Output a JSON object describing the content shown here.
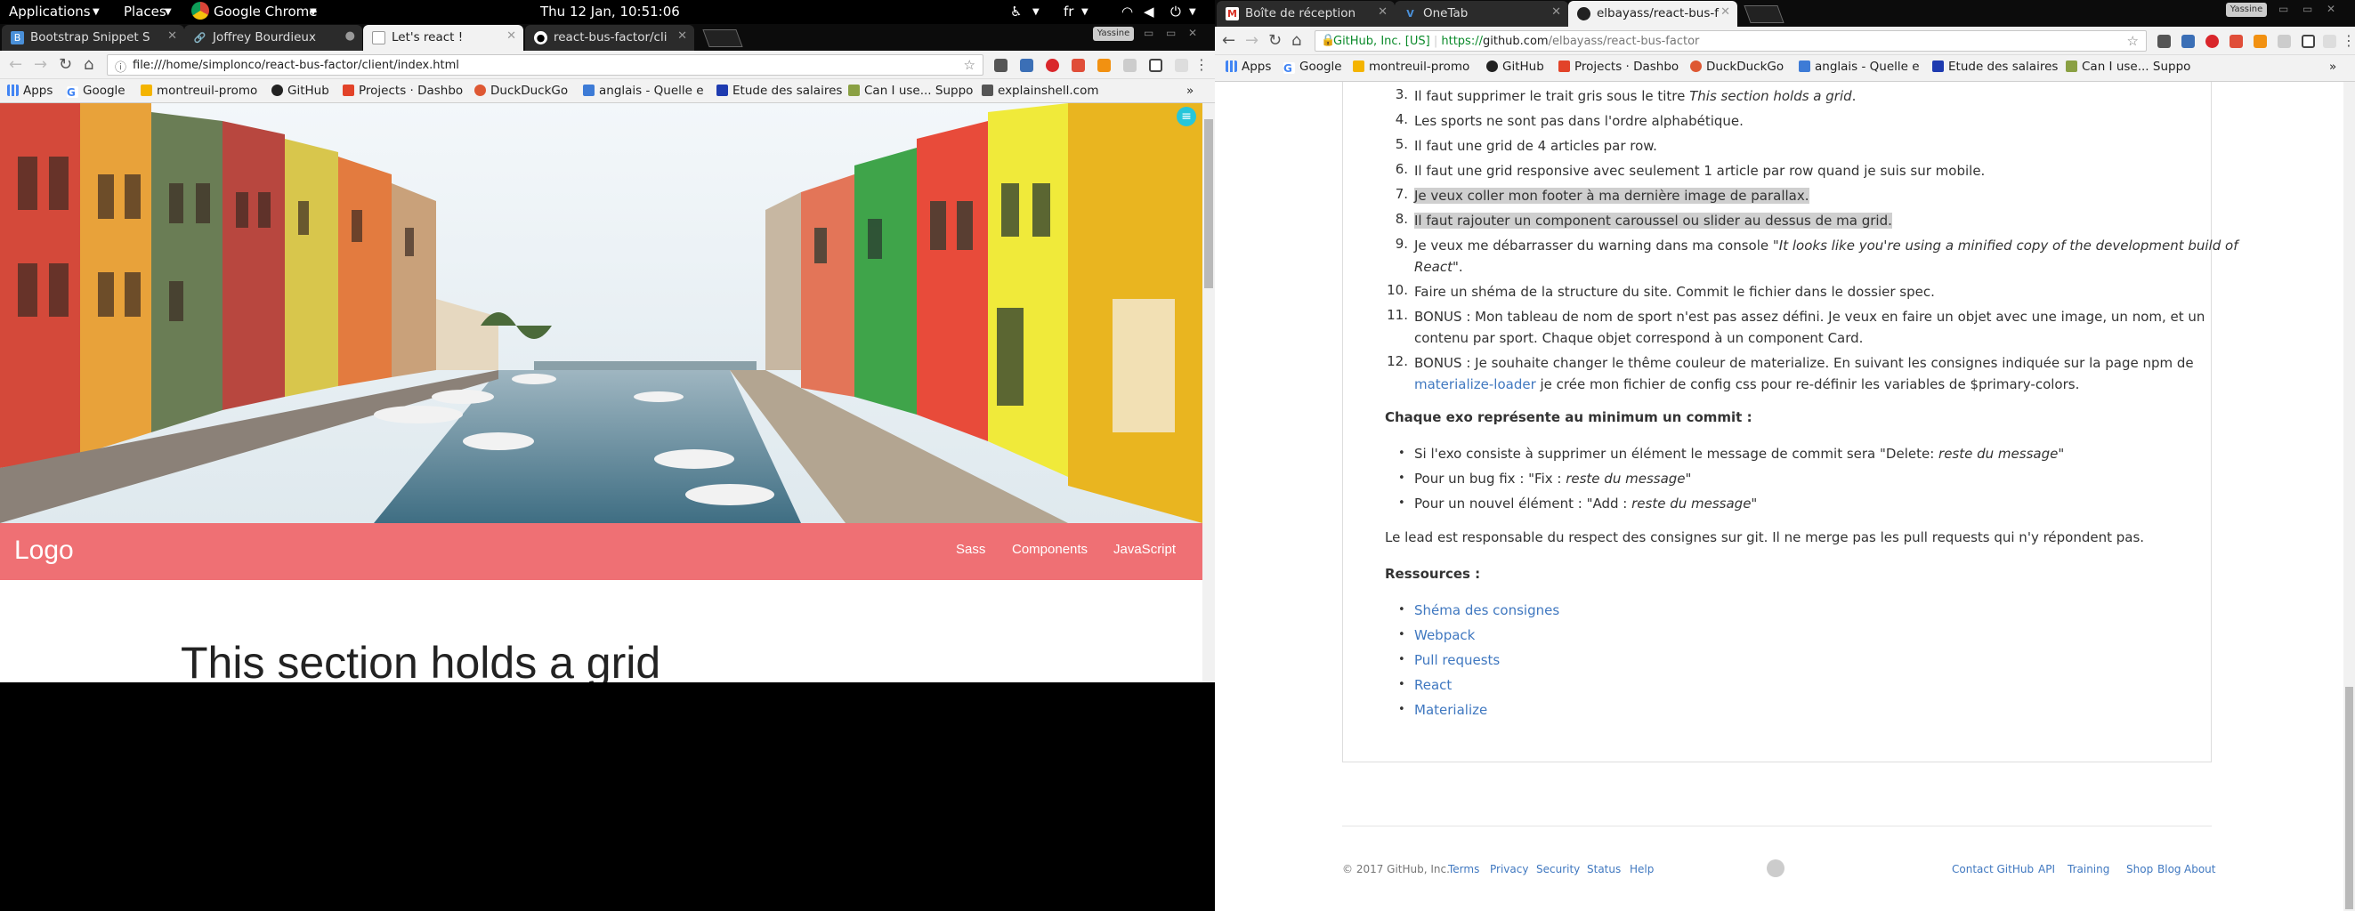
{
  "panel": {
    "applications": "Applications",
    "places": "Places",
    "app_name": "Google Chrome",
    "clock": "Thu 12 Jan, 10:51:06",
    "lang": "fr",
    "user": "Yassine"
  },
  "left_browser": {
    "tabs": [
      {
        "label": "Bootstrap Snippet S",
        "fav": "B",
        "active": false
      },
      {
        "label": "Joffrey Bourdieux",
        "fav": "",
        "active": false
      },
      {
        "label": "Let's react !",
        "fav": "",
        "active": true
      },
      {
        "label": "react-bus-factor/cli",
        "fav": "",
        "active": false
      }
    ],
    "url": "file:///home/simplonco/react-bus-factor/client/index.html",
    "bookmarks": [
      "Apps",
      "Google",
      "montreuil-promo",
      "GitHub",
      "Projects · Dashbo",
      "DuckDuckGo",
      "anglais - Quelle e",
      "Etude des salaires",
      "Can I use... Suppo",
      "explainshell.com"
    ],
    "page": {
      "logo": "Logo",
      "nav": [
        "Sass",
        "Components",
        "JavaScript"
      ],
      "section_title": "This section holds a grid"
    }
  },
  "right_browser": {
    "tabs": [
      {
        "label": "Boîte de réception",
        "active": false
      },
      {
        "label": "OneTab",
        "active": false
      },
      {
        "label": "elbayass/react-bus-f",
        "active": true
      }
    ],
    "site_identity": "GitHub, Inc. [US]",
    "url_scheme": "https://",
    "url_host": "github.com",
    "url_path": "/elbayass/react-bus-factor",
    "bookmarks": [
      "Apps",
      "Google",
      "montreuil-promo",
      "GitHub",
      "Projects · Dashbo",
      "DuckDuckGo",
      "anglais - Quelle e",
      "Etude des salaires",
      "Can I use... Suppo"
    ],
    "readme": {
      "items": [
        {
          "n": "3.",
          "text": "Il faut supprimer le trait gris sous le titre ",
          "em": "This section holds a grid",
          "tail": "."
        },
        {
          "n": "4.",
          "text": "Les sports ne sont pas dans l'ordre alphabétique."
        },
        {
          "n": "5.",
          "text": "Il faut une grid de 4 articles par row."
        },
        {
          "n": "6.",
          "text": "Il faut une grid responsive avec seulement 1 article par row quand je suis sur mobile."
        },
        {
          "n": "7.",
          "text": "Je veux coller mon footer à ma dernière image de parallax."
        },
        {
          "n": "8.",
          "text": "Il faut rajouter un component caroussel ou slider au dessus de ma grid."
        },
        {
          "n": "9.",
          "text": "Je veux me débarrasser du warning dans ma console ",
          "em": "\"It looks like you're using a minified copy of the development build of",
          "line2_em": "React\"",
          "line2_tail": "."
        },
        {
          "n": "10.",
          "text": "Faire un shéma de la structure du site. Commit le fichier dans le dossier spec."
        },
        {
          "n": "11.",
          "text": "BONUS : Mon tableau de nom de sport n'est pas assez défini. Je veux en faire un objet avec une image, un nom, et un",
          "line2": "contenu par sport. Chaque objet correspond à un component Card."
        },
        {
          "n": "12.",
          "text": "BONUS : Je souhaite changer le thême couleur de materialize. En suivant les consignes indiquée sur la page npm de",
          "line2_link": "materialize-loader",
          "line2": " je crée mon fichier de config css pour re-définir les variables de $primary-colors."
        }
      ],
      "commit_heading": "Chaque exo représente au minimum un commit :",
      "commit_rules": [
        {
          "text": "Si l'exo consiste à supprimer un élément le message de commit sera \"Delete: ",
          "em": "reste du message",
          "tail": "\""
        },
        {
          "text": "Pour un bug fix : \"Fix : ",
          "em": "reste du message",
          "tail": "\""
        },
        {
          "text": "Pour un nouvel élément : \"Add : ",
          "em": "reste du message",
          "tail": "\""
        }
      ],
      "lead_note": "Le lead est responsable du respect des consignes sur git. Il ne merge pas les pull requests qui n'y répondent pas.",
      "resources_heading": "Ressources :",
      "resources": [
        "Shéma des consignes",
        "Webpack",
        "Pull requests",
        "React",
        "Materialize"
      ]
    },
    "footer": {
      "copyright": "© 2017 GitHub, Inc.",
      "left_links": [
        "Terms",
        "Privacy",
        "Security",
        "Status",
        "Help"
      ],
      "right_links": [
        "Contact GitHub",
        "API",
        "Training",
        "Shop",
        "Blog",
        "About"
      ]
    }
  },
  "colors": {
    "navbar": "#ef7074",
    "link": "#4078c0",
    "panel": "#000000"
  }
}
